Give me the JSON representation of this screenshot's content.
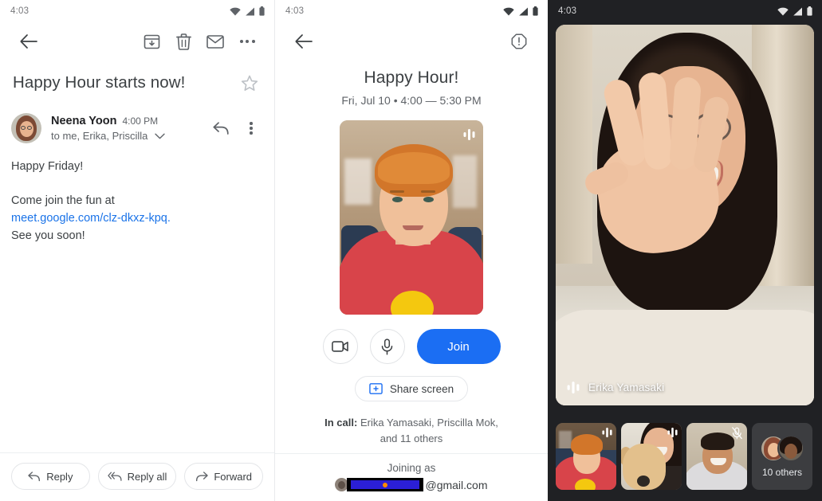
{
  "panes": {
    "email": {
      "statusbar": {
        "time": "4:03",
        "icons": [
          "wifi-icon",
          "cellular-signal-icon",
          "battery-icon"
        ]
      },
      "toolbar": {
        "back_label": "Back",
        "actions": [
          {
            "name": "archive-button",
            "label": "Archive"
          },
          {
            "name": "delete-button",
            "label": "Delete"
          },
          {
            "name": "mark-unread-button",
            "label": "Mark as unread"
          },
          {
            "name": "more-options-button",
            "label": "More options"
          }
        ]
      },
      "subject": "Happy Hour starts now!",
      "star_label": "Star",
      "sender": {
        "name": "Neena Yoon",
        "time": "4:00 PM",
        "recipients": "to me, Erika, Priscilla",
        "expand_label": "Show details",
        "reply_label": "Reply",
        "more_label": "More"
      },
      "body": {
        "line1": "Happy Friday!",
        "line2": "Come join the fun at",
        "link": "meet.google.com/clz-dkxz-kpq.",
        "line3": "See you soon!"
      },
      "footer_actions": [
        {
          "name": "reply-button",
          "label": "Reply",
          "icon": "reply-icon"
        },
        {
          "name": "reply-all-button",
          "label": "Reply all",
          "icon": "reply-all-icon"
        },
        {
          "name": "forward-button",
          "label": "Forward",
          "icon": "forward-icon"
        }
      ]
    },
    "meet_invite": {
      "statusbar": {
        "time": "4:03"
      },
      "back_label": "Back",
      "report_label": "Report a problem",
      "title": "Happy Hour!",
      "subtitle": "Fri, Jul 10  •  4:00 — 5:30 PM",
      "preview_audio_icon": "audio-level-icon",
      "controls": [
        {
          "name": "camera-toggle",
          "label": "Turn off camera",
          "icon": "video-camera-icon"
        },
        {
          "name": "microphone-toggle",
          "label": "Turn off microphone",
          "icon": "microphone-icon"
        }
      ],
      "join_label": "Join",
      "share_screen_label": "Share screen",
      "share_screen_icon": "present-screen-icon",
      "in_call_prefix": "In call:",
      "in_call_names": "Erika Yamasaki, Priscilla Mok,",
      "in_call_more": "and 11 others",
      "joining_as_label": "Joining as",
      "account_redacted": true,
      "account_domain": "@gmail.com"
    },
    "video_call": {
      "statusbar": {
        "time": "4:03"
      },
      "active_speaker": {
        "name": "Erika Yamasaki",
        "audio_icon": "audio-level-icon"
      },
      "thumbnails": [
        {
          "name": "participant-thumbnail-1",
          "badge": "audio-level-icon",
          "label": ""
        },
        {
          "name": "participant-thumbnail-2",
          "badge": "audio-level-icon",
          "label": ""
        },
        {
          "name": "participant-thumbnail-3",
          "badge": "microphone-muted-icon",
          "label": ""
        },
        {
          "name": "participant-thumbnail-others",
          "badge": "",
          "label": "10 others"
        }
      ]
    }
  },
  "colors": {
    "accent_blue": "#1b6ef3",
    "link_blue": "#1a73e8",
    "text_primary": "#3c4043",
    "text_secondary": "#5f6368",
    "dark_bg": "#202124",
    "thumb_bg": "#3c3d40"
  }
}
